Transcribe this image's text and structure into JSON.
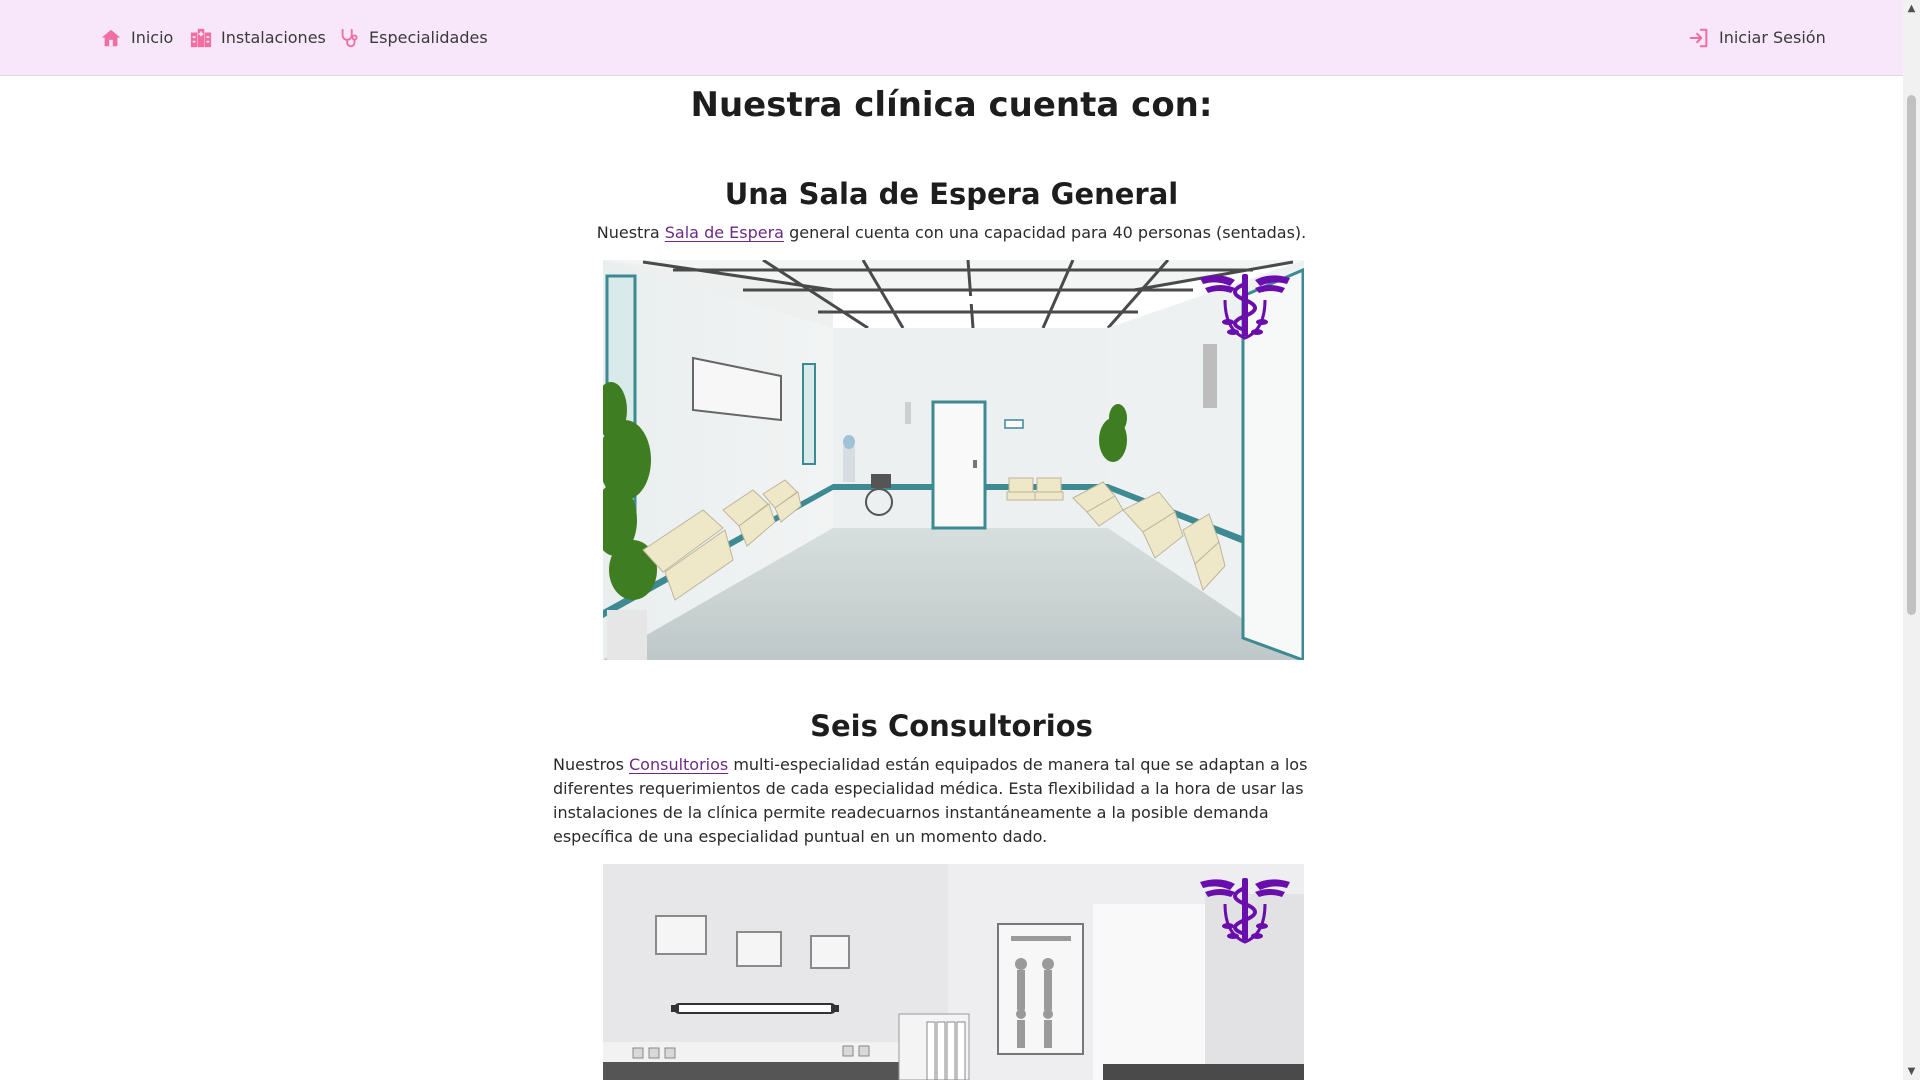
{
  "navbar": {
    "items": [
      {
        "label": "Inicio",
        "icon": "home-icon"
      },
      {
        "label": "Instalaciones",
        "icon": "hospital-buildings-icon"
      },
      {
        "label": "Especialidades",
        "icon": "stethoscope-icon"
      }
    ],
    "login": {
      "label": "Iniciar Sesión",
      "icon": "sign-in-icon"
    }
  },
  "main": {
    "title": "Nuestra clínica cuenta con:",
    "sections": [
      {
        "title": "Una Sala de Espera General",
        "text_before": "Nuestra ",
        "link": "Sala de Espera",
        "text_after": " general cuenta con una capacidad para 40 personas (sentadas).",
        "image": "waiting-room-photo"
      },
      {
        "title": "Seis Consultorios",
        "text_before": "Nuestros ",
        "link": "Consultorios",
        "text_after": " multi-especialidad están equipados de manera tal que se adaptan a los diferentes requerimientos de cada especialidad médica. Esta flexibilidad a la hora de usar las instalaciones de la clínica permite readecuarnos instantáneamente a la posible demanda específica de una especialidad puntual en un momento dado.",
        "image": "consulting-room-photo"
      }
    ]
  },
  "colors": {
    "navbar_bg": "#f8e6fb",
    "icon_pink": "#ee6fa0",
    "link_purple": "#6d2a84",
    "logo_purple": "#6a0dad"
  }
}
